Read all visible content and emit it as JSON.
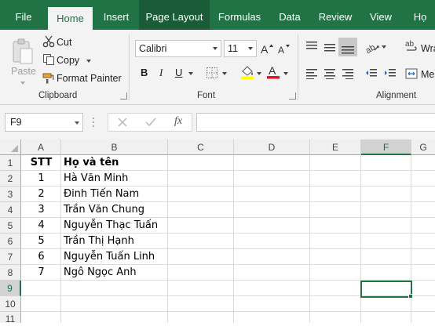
{
  "tabs": [
    {
      "label": "File"
    },
    {
      "label": "Home"
    },
    {
      "label": "Insert"
    },
    {
      "label": "Page Layout"
    },
    {
      "label": "Formulas"
    },
    {
      "label": "Data"
    },
    {
      "label": "Review"
    },
    {
      "label": "View"
    },
    {
      "label": "Họ"
    }
  ],
  "active_tab": "Home",
  "colors": {
    "brand": "#217346",
    "font_color_bar": "#e81123",
    "highlight_bar": "#ffff00"
  },
  "ribbon": {
    "clipboard": {
      "paste_label": "Paste",
      "cut_label": "Cut",
      "copy_label": "Copy",
      "format_painter_label": "Format Painter",
      "group_label": "Clipboard"
    },
    "font": {
      "font_name": "Calibri",
      "font_size": "11",
      "bold": "B",
      "italic": "I",
      "underline": "U",
      "group_label": "Font"
    },
    "alignment": {
      "wrap_label": "Wra",
      "merge_label": "Me",
      "group_label": "Alignment"
    }
  },
  "formula_bar": {
    "name_box": "F9",
    "fx_label": "fx",
    "formula": ""
  },
  "sheet": {
    "columns": [
      "A",
      "B",
      "C",
      "D",
      "E",
      "F",
      "G"
    ],
    "rows": [
      "1",
      "2",
      "3",
      "4",
      "5",
      "6",
      "7",
      "8",
      "9",
      "10",
      "11"
    ],
    "selected_cell": "F9",
    "header": {
      "stt": "STT",
      "name": "Họ và tên"
    },
    "data": [
      {
        "stt": "1",
        "name": "Hà Văn Minh"
      },
      {
        "stt": "2",
        "name": "Đinh Tiến Nam"
      },
      {
        "stt": "3",
        "name": "Trần Văn Chung"
      },
      {
        "stt": "4",
        "name": "Nguyễn Thạc Tuấn"
      },
      {
        "stt": "5",
        "name": "Trần Thị Hạnh"
      },
      {
        "stt": "6",
        "name": "Nguyễn Tuấn Linh"
      },
      {
        "stt": "7",
        "name": "Ngô Ngọc Anh"
      }
    ]
  }
}
